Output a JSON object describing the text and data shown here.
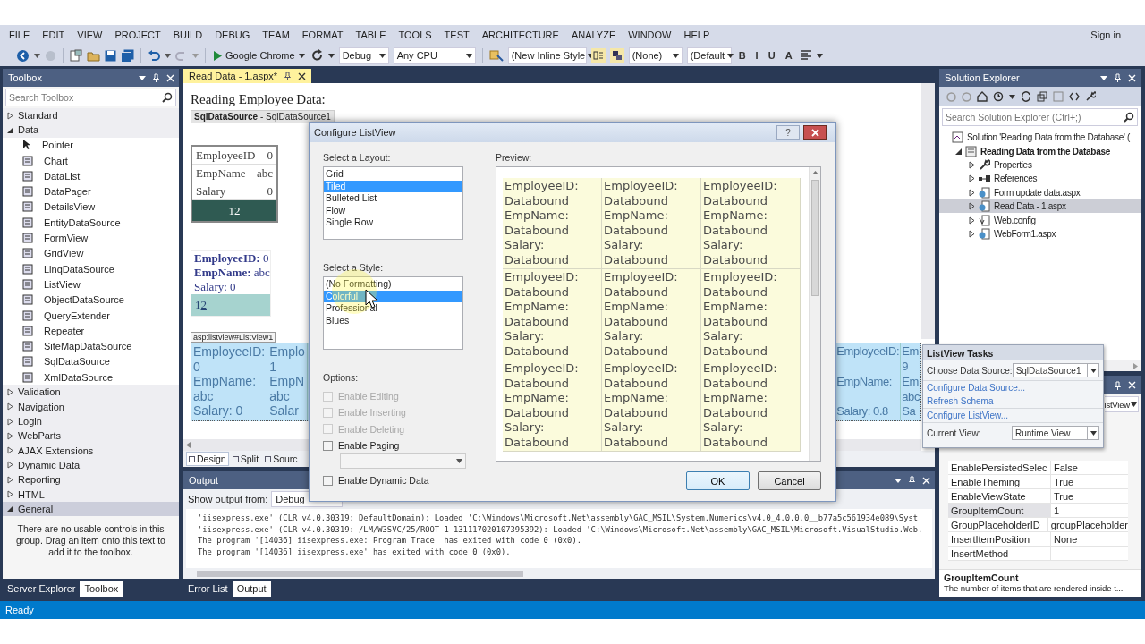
{
  "menu": [
    "FILE",
    "EDIT",
    "VIEW",
    "PROJECT",
    "BUILD",
    "DEBUG",
    "TEAM",
    "FORMAT",
    "TABLE",
    "TOOLS",
    "TEST",
    "ARCHITECTURE",
    "ANALYZE",
    "WINDOW",
    "HELP"
  ],
  "sign_in": "Sign in",
  "toolbar": {
    "browser": "Google Chrome",
    "configuration": "Debug",
    "platform": "Any CPU",
    "inline_style": "(New Inline Style",
    "target_rule": "(None)",
    "font": "(Default",
    "format_buttons": [
      "B",
      "I",
      "U",
      "A"
    ]
  },
  "toolbox": {
    "title": "Toolbox",
    "search_placeholder": "Search Toolbox",
    "items": [
      {
        "label": "Standard",
        "expanded": false,
        "selected": false
      },
      {
        "label": "Data",
        "expanded": true,
        "selected": false,
        "children": [
          {
            "label": "Pointer"
          },
          {
            "label": "Chart"
          },
          {
            "label": "DataList"
          },
          {
            "label": "DataPager"
          },
          {
            "label": "DetailsView"
          },
          {
            "label": "EntityDataSource"
          },
          {
            "label": "FormView"
          },
          {
            "label": "GridView"
          },
          {
            "label": "LinqDataSource"
          },
          {
            "label": "ListView"
          },
          {
            "label": "ObjectDataSource"
          },
          {
            "label": "QueryExtender"
          },
          {
            "label": "Repeater"
          },
          {
            "label": "SiteMapDataSource"
          },
          {
            "label": "SqlDataSource"
          },
          {
            "label": "XmlDataSource"
          }
        ]
      },
      {
        "label": "Validation",
        "expanded": false,
        "selected": false
      },
      {
        "label": "Navigation",
        "expanded": false,
        "selected": false
      },
      {
        "label": "Login",
        "expanded": false,
        "selected": false
      },
      {
        "label": "WebParts",
        "expanded": false,
        "selected": false
      },
      {
        "label": "AJAX Extensions",
        "expanded": false,
        "selected": false
      },
      {
        "label": "Dynamic Data",
        "expanded": false,
        "selected": false
      },
      {
        "label": "Reporting",
        "expanded": false,
        "selected": false
      },
      {
        "label": "HTML",
        "expanded": false,
        "selected": false
      },
      {
        "label": "General",
        "expanded": true,
        "selected": true
      }
    ],
    "empty_message": "There are no usable controls in this group. Drag an item onto this text to add it to the toolbox.",
    "tabs": [
      {
        "label": "Server Explorer",
        "selected": false
      },
      {
        "label": "Toolbox",
        "selected": true
      }
    ]
  },
  "document": {
    "tabs": [
      {
        "label": "Read Data - 1.aspx*",
        "selected": true
      }
    ],
    "heading": "Reading Employee Data:",
    "datasource_tag": "**SqlDataSource** - SqlDataSource1",
    "details_view": {
      "rows": [
        {
          "field": "EmployeeID",
          "value": "0"
        },
        {
          "field": "EmpName",
          "value": "abc"
        },
        {
          "field": "Salary",
          "value": "0"
        }
      ],
      "pages": [
        {
          "label": "1",
          "kind": "current"
        },
        {
          "label": "2",
          "kind": "link"
        }
      ]
    },
    "form_view": {
      "lines": [
        "**EmployeeID:** 0",
        "**EmpName:** abc",
        "Salary: 0"
      ],
      "pages": [
        {
          "label": "1",
          "kind": "current"
        },
        {
          "label": "2",
          "kind": "link"
        }
      ]
    },
    "listview_tag": "asp:listview#ListView1",
    "listview_tiles": [
      {
        "lines": [
          "EmployeeID:",
          "0",
          "EmpName:",
          "abc",
          "Salary: 0"
        ]
      },
      {
        "lines": [
          "Emplo",
          "1",
          "EmpN",
          "abc",
          "Salar"
        ]
      }
    ],
    "listview_tiles_right": [
      {
        "lines": [
          "EmployeeID:",
          "EmpName:",
          "Salary: 0.8"
        ]
      },
      {
        "lines": [
          "Em",
          "9",
          "Em",
          "abc",
          "Sa"
        ]
      }
    ],
    "view_tabs": [
      {
        "label": "Design",
        "selected": true
      },
      {
        "label": "Split",
        "selected": false
      },
      {
        "label": "Sourc",
        "selected": false
      }
    ]
  },
  "output": {
    "title": "Output",
    "show_from_label": "Show output from:",
    "source": "Debug",
    "lines": [
      "'iisexpress.exe' (CLR v4.0.30319: DefaultDomain): Loaded 'C:\\Windows\\Microsoft.Net\\assembly\\GAC_MSIL\\System.Numerics\\v4.0_4.0.0.0__b77a5c561934e089\\Syst",
      "'iisexpress.exe' (CLR v4.0.30319: /LM/W3SVC/25/ROOT-1-131117020107395392): Loaded 'C:\\Windows\\Microsoft.Net\\assembly\\GAC_MSIL\\Microsoft.VisualStudio.Web.",
      "The program '[14036] iisexpress.exe: Program Trace' has exited with code 0 (0x0).",
      "The program '[14036] iisexpress.exe' has exited with code 0 (0x0)."
    ],
    "tabs": [
      {
        "label": "Error List",
        "selected": false
      },
      {
        "label": "Output",
        "selected": true
      }
    ]
  },
  "solution_explorer": {
    "title": "Solution Explorer",
    "search_placeholder": "Search Solution Explorer (Ctrl+;)",
    "tree": [
      {
        "label": "Solution 'Reading Data from the Database' (",
        "kind": "solution",
        "selected": false,
        "children": [
          {
            "label": "Reading Data from the Database",
            "kind": "project",
            "expanded": true,
            "selected": false,
            "children": [
              {
                "label": "Properties",
                "kind": "properties",
                "expanded": false,
                "selected": false
              },
              {
                "label": "References",
                "kind": "references",
                "expanded": false,
                "selected": false
              },
              {
                "label": "Form update data.aspx",
                "kind": "page",
                "expanded": false,
                "selected": false
              },
              {
                "label": "Read Data - 1.aspx",
                "kind": "page",
                "expanded": false,
                "selected": true
              },
              {
                "label": "Web.config",
                "kind": "config",
                "expanded": false,
                "selected": false
              },
              {
                "label": "WebForm1.aspx",
                "kind": "page",
                "expanded": false,
                "selected": false
              }
            ]
          }
        ]
      }
    ]
  },
  "properties": {
    "object_type": "istView",
    "rows": [
      {
        "name": "EnablePersistedSelec",
        "value": "False",
        "selected": false
      },
      {
        "name": "EnableTheming",
        "value": "True",
        "selected": false
      },
      {
        "name": "EnableViewState",
        "value": "True",
        "selected": false
      },
      {
        "name": "GroupItemCount",
        "value": "1",
        "selected": true
      },
      {
        "name": "GroupPlaceholderID",
        "value": "groupPlaceholder",
        "selected": false
      },
      {
        "name": "InsertItemPosition",
        "value": "None",
        "selected": false
      },
      {
        "name": "InsertMethod",
        "selected": false
      }
    ],
    "description_title": "GroupItemCount",
    "description": "The number of items that are rendered inside t..."
  },
  "dialog": {
    "title": "Configure ListView",
    "help_button": "?",
    "layout_label": "Select a Layout:",
    "layouts": [
      {
        "label": "Grid",
        "selected": false
      },
      {
        "label": "Tiled",
        "selected": true
      },
      {
        "label": "Bulleted List",
        "selected": false
      },
      {
        "label": "Flow",
        "selected": false
      },
      {
        "label": "Single Row",
        "selected": false
      }
    ],
    "style_label": "Select a Style:",
    "styles": [
      {
        "label": "(No Formatting)",
        "selected": false
      },
      {
        "label": "Colorful",
        "selected": true
      },
      {
        "label": "Professional",
        "selected": false
      },
      {
        "label": "Blues",
        "selected": false
      }
    ],
    "options_label": "Options:",
    "options": [
      {
        "label": "Enable Editing",
        "checked": false,
        "disabled": true,
        "kind": "checkbox"
      },
      {
        "label": "Enable Inserting",
        "checked": false,
        "disabled": true,
        "kind": "checkbox"
      },
      {
        "label": "Enable Deleting",
        "checked": false,
        "disabled": true,
        "kind": "checkbox"
      },
      {
        "label": "Enable Paging",
        "checked": false,
        "disabled": false,
        "kind": "checkbox"
      },
      {
        "kind": "dropdown"
      },
      {
        "label": "Enable Dynamic Data",
        "checked": false,
        "disabled": false,
        "kind": "checkbox"
      }
    ],
    "preview_label": "Preview:",
    "preview_tiles": [
      {
        "lines": [
          "EmployeeID:",
          "Databound",
          "EmpName:",
          "Databound",
          "Salary:",
          "Databound"
        ]
      },
      {
        "lines": [
          "EmployeeID:",
          "Databound",
          "EmpName:",
          "Databound",
          "Salary:",
          "Databound"
        ]
      },
      {
        "lines": [
          "EmployeeID:",
          "Databound",
          "EmpName:",
          "Databound",
          "Salary:",
          "Databound"
        ]
      },
      {
        "lines": [
          "EmployeeID:",
          "Databound",
          "EmpName:",
          "Databound",
          "Salary:",
          "Databound"
        ]
      },
      {
        "lines": [
          "EmployeeID:",
          "Databound",
          "EmpName:",
          "Databound",
          "Salary:",
          "Databound"
        ]
      },
      {
        "lines": [
          "EmployeeID:",
          "Databound",
          "EmpName:",
          "Databound",
          "Salary:",
          "Databound"
        ]
      },
      {
        "lines": [
          "EmployeeID:",
          "Databound",
          "EmpName:",
          "Databound",
          "Salary:",
          "Databound"
        ]
      },
      {
        "lines": [
          "EmployeeID:",
          "Databound",
          "EmpName:",
          "Databound",
          "Salary:",
          "Databound"
        ]
      },
      {
        "lines": [
          "EmployeeID:",
          "Databound",
          "EmpName:",
          "Databound",
          "Salary:",
          "Databound"
        ]
      }
    ],
    "buttons": [
      "OK",
      "Cancel"
    ]
  },
  "tasks": {
    "title": "ListView Tasks",
    "data_source_label": "Choose Data Source:",
    "data_source": "SqlDataSource1",
    "links": [
      "Configure Data Source...",
      "Refresh Schema",
      "Configure ListView..."
    ],
    "view_label": "Current View:",
    "view": "Runtime View"
  },
  "status_bar": {
    "text": "Ready"
  }
}
